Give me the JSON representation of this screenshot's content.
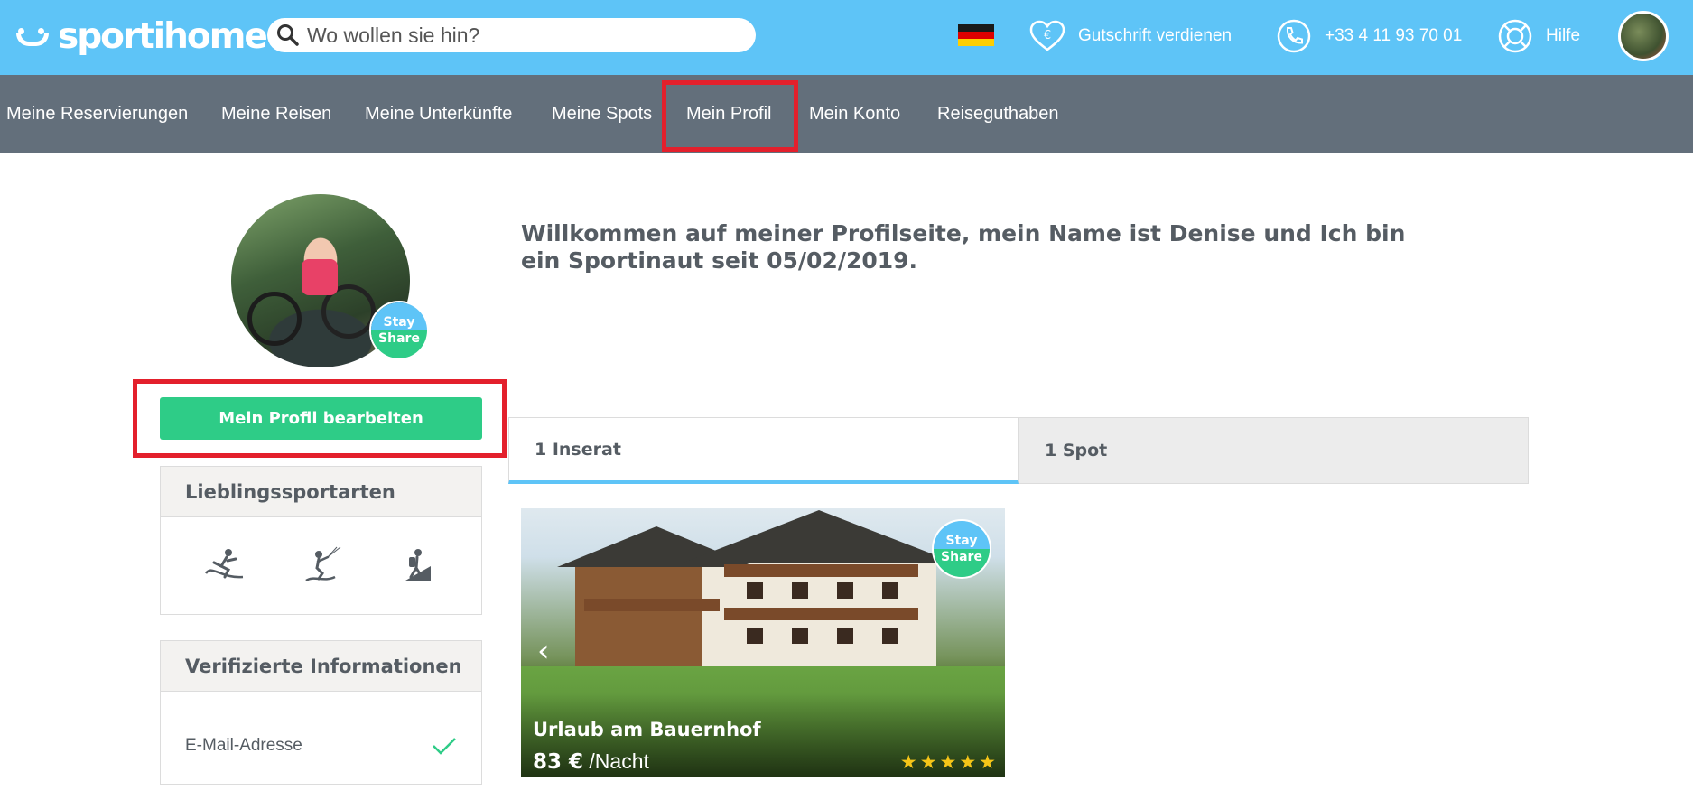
{
  "header": {
    "brand": "sportihome",
    "search_placeholder": "Wo wollen sie hin?",
    "language_flag": "germany-flag",
    "credit_label": "Gutschrift verdienen",
    "phone": "+33 4 11 93 70 01",
    "help_label": "Hilfe",
    "colors": {
      "bar": "#5ec4f7"
    }
  },
  "nav": {
    "items": [
      {
        "label": "Meine Reservierungen"
      },
      {
        "label": "Meine Reisen"
      },
      {
        "label": "Meine Unterkünfte"
      },
      {
        "label": "Meine Spots"
      },
      {
        "label": "Mein Profil",
        "active": true
      },
      {
        "label": "Mein Konto"
      },
      {
        "label": "Reiseguthaben"
      }
    ],
    "colors": {
      "bar": "#636f7b"
    }
  },
  "profile": {
    "badge_stay": "Stay",
    "badge_share": "Share",
    "edit_button": "Mein Profil bearbeiten",
    "welcome": "Willkommen auf meiner Profilseite, mein Name ist Denise und Ich bin ein Sportinaut seit 05/02/2019."
  },
  "favorite_sports": {
    "title": "Lieblingssportarten",
    "icons": [
      "surfing-icon",
      "kitesurfing-icon",
      "hiking-icon"
    ]
  },
  "verified": {
    "title": "Verifizierte Informationen",
    "items": [
      {
        "label": "E-Mail-Adresse",
        "verified": true
      }
    ]
  },
  "tabs": [
    {
      "label": "1 Inserat",
      "active": true
    },
    {
      "label": "1 Spot",
      "active": false
    }
  ],
  "listing": {
    "title": "Urlaub am Bauernhof",
    "price": "83 €",
    "price_unit": "/Nacht",
    "rating": 5,
    "badge_stay": "Stay",
    "badge_share": "Share"
  },
  "colors": {
    "accent_green": "#2ecc87",
    "accent_blue": "#5ec4f7",
    "highlight_red": "#e3202c"
  }
}
